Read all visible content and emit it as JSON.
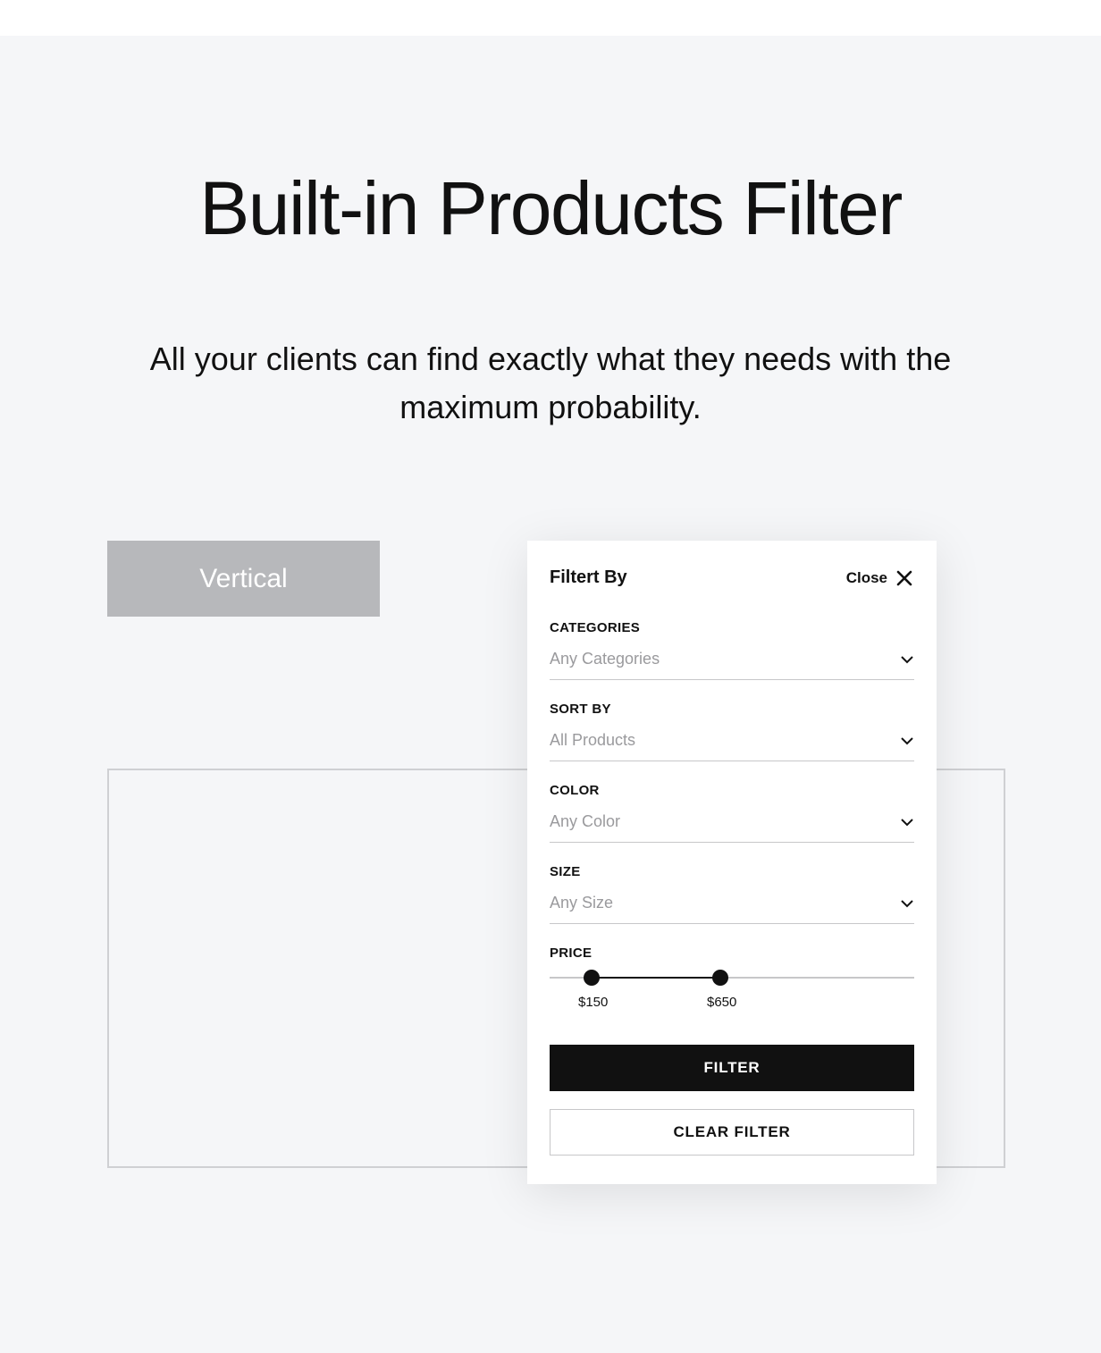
{
  "header": {
    "title": "Built-in Products Filter",
    "subtitle": "All your clients can find exactly what they needs with the maximum probability."
  },
  "tabs": {
    "vertical_label": "Vertical"
  },
  "filter": {
    "title": "Filtert By",
    "close_label": "Close",
    "categories": {
      "label": "CATEGORIES",
      "value": "Any Categories"
    },
    "sort_by": {
      "label": "SORT BY",
      "value": "All Products"
    },
    "color": {
      "label": "COLOR",
      "value": "Any Color"
    },
    "size": {
      "label": "SIZE",
      "value": "Any Size"
    },
    "price": {
      "label": "PRICE",
      "min_display": "$150",
      "max_display": "$650"
    },
    "buttons": {
      "filter": "FILTER",
      "clear": "CLEAR FILTER"
    }
  }
}
